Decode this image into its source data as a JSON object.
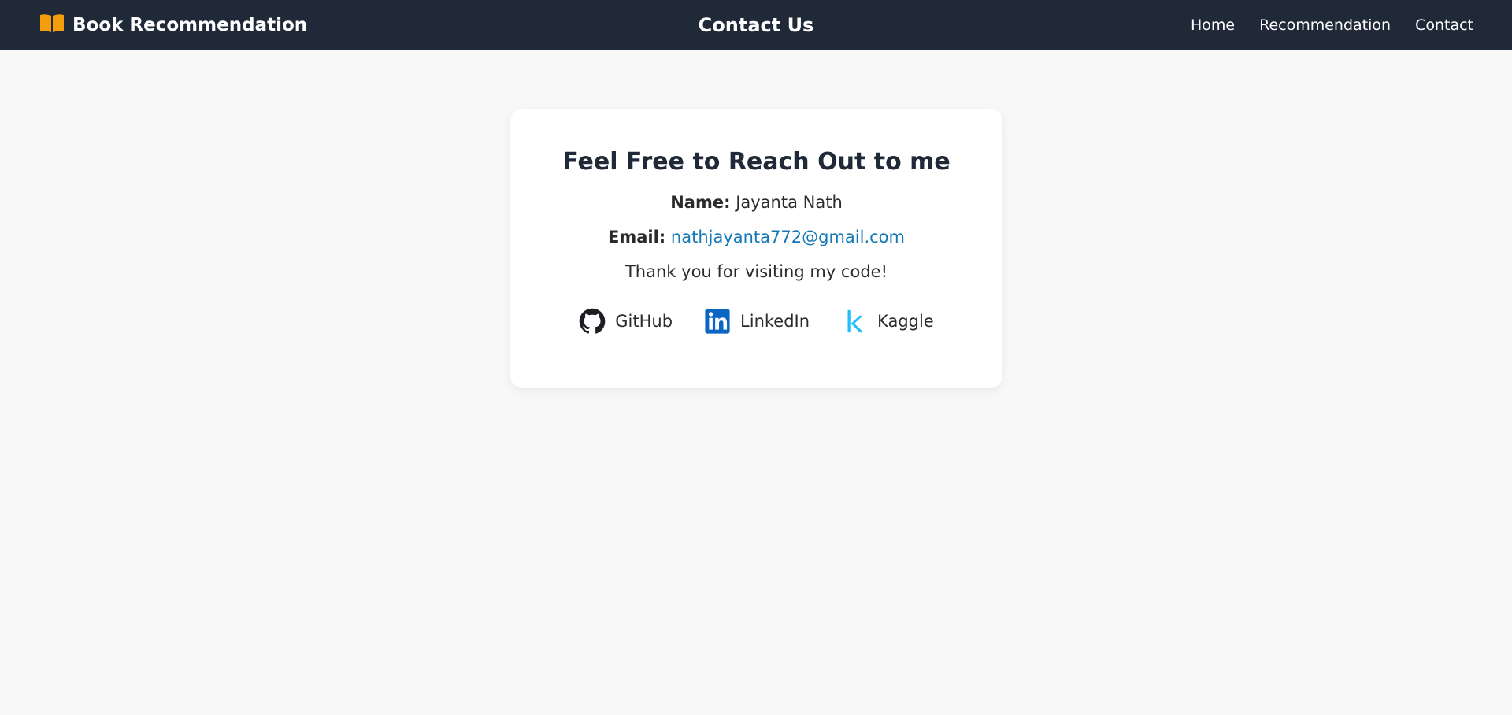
{
  "navbar": {
    "brand_icon": "open-book-icon",
    "brand_label": "Book Recommendation",
    "title": "Contact Us",
    "links": [
      {
        "label": "Home"
      },
      {
        "label": "Recommendation"
      },
      {
        "label": "Contact"
      }
    ],
    "background_color": "#1f2937",
    "brand_icon_color": "#f59e0b"
  },
  "card": {
    "heading": "Feel Free to Reach Out to me",
    "name_label": "Name:",
    "name_value": "Jayanta Nath",
    "email_label": "Email:",
    "email_value": "nathjayanta772@gmail.com",
    "thanks": "Thank you for visiting my code!",
    "socials": [
      {
        "label": "GitHub",
        "icon": "github-icon"
      },
      {
        "label": "LinkedIn",
        "icon": "linkedin-icon"
      },
      {
        "label": "Kaggle",
        "icon": "kaggle-icon"
      }
    ],
    "link_color": "#1378b5"
  }
}
